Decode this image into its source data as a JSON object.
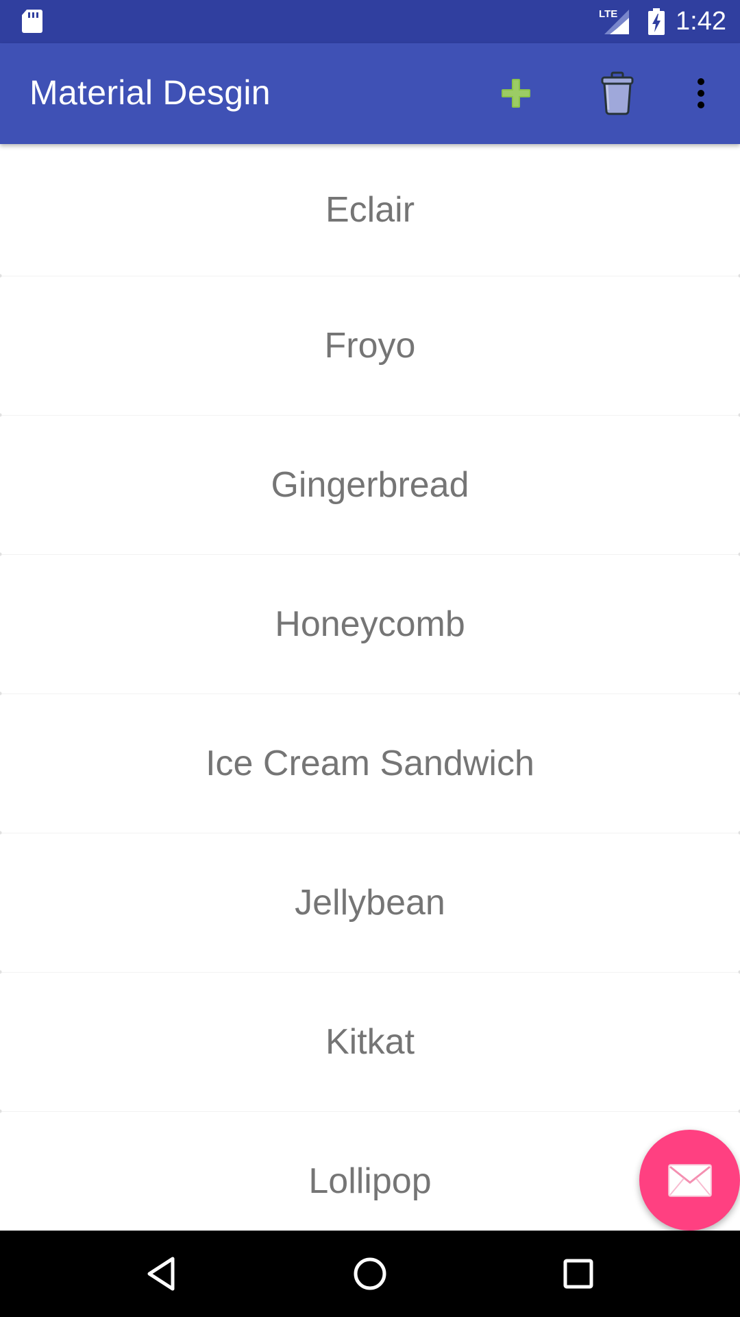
{
  "status_bar": {
    "time": "1:42",
    "network_label": "LTE",
    "icons": [
      "sd-card-icon",
      "lte-signal-icon",
      "battery-charging-icon"
    ]
  },
  "app_bar": {
    "title": "Material Desgin",
    "actions": [
      {
        "name": "add",
        "icon": "plus-icon",
        "color": "#8bc34a"
      },
      {
        "name": "delete",
        "icon": "trash-icon",
        "color": "#9fa8da"
      },
      {
        "name": "more",
        "icon": "more-vert-icon",
        "color": "#000000"
      }
    ],
    "background": "#3f51b5",
    "status_background": "#303f9f"
  },
  "list": {
    "items": [
      {
        "label": "Eclair"
      },
      {
        "label": "Froyo"
      },
      {
        "label": "Gingerbread"
      },
      {
        "label": "Honeycomb"
      },
      {
        "label": "Ice Cream Sandwich"
      },
      {
        "label": "Jellybean"
      },
      {
        "label": "Kitkat"
      },
      {
        "label": "Lollipop"
      }
    ],
    "text_color": "#757575"
  },
  "fab": {
    "icon": "mail-icon",
    "color": "#ff4081"
  },
  "nav_bar": {
    "buttons": [
      "back-icon",
      "home-icon",
      "recents-icon"
    ]
  }
}
